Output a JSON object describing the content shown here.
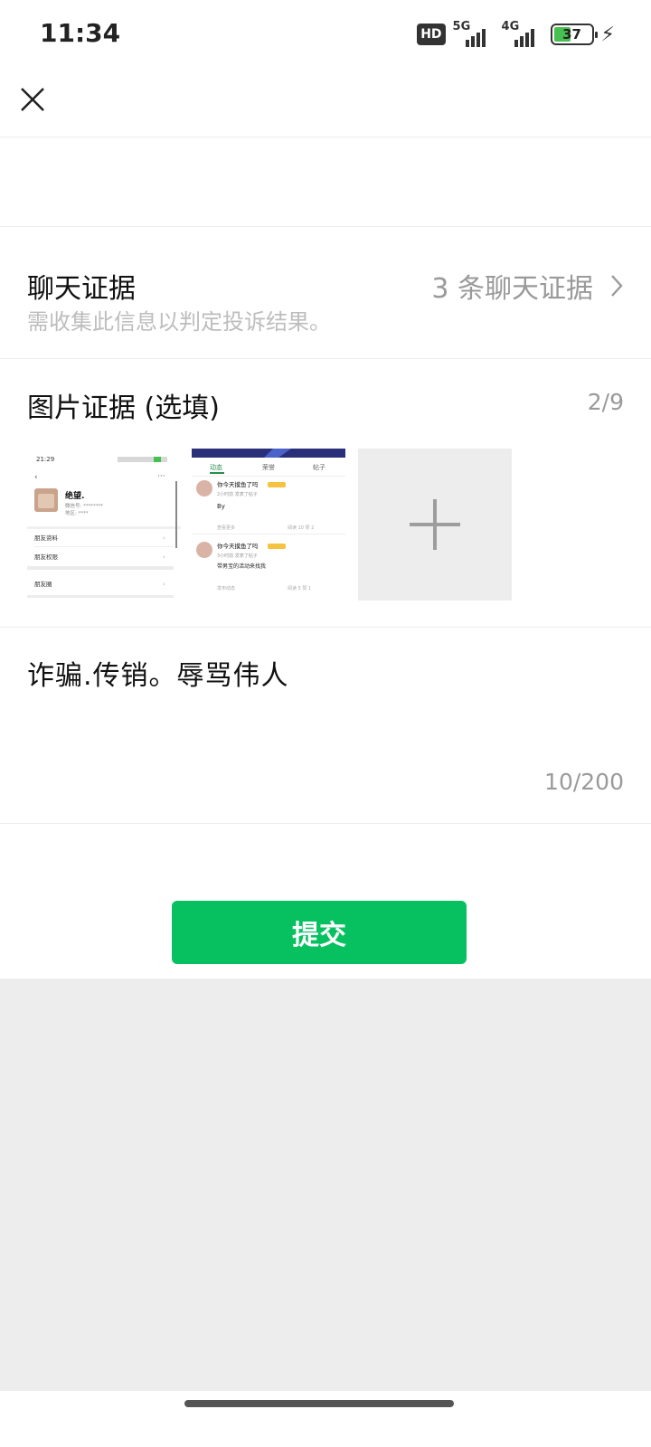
{
  "status_bar": {
    "time": "11:34",
    "hd_label": "HD",
    "network1": "5G",
    "network2": "4G",
    "battery": "37"
  },
  "form": {
    "chat_evidence": {
      "title": "聊天证据",
      "hint": "需收集此信息以判定投诉结果。",
      "value": "3 条聊天证据"
    },
    "image_evidence": {
      "title": "图片证据 (选填)",
      "counter": "2/9",
      "thumbnails": [
        {
          "time": "21:29",
          "profile_name": "绝望.",
          "id_line": "微信号: ********",
          "region_line": "地区: ****",
          "rows": [
            "朋友资料",
            "朋友权限",
            "朋友圈"
          ]
        },
        {
          "tabs": [
            "动态",
            "荣誉",
            "帖子"
          ],
          "posts": [
            {
              "name": "你今天摸鱼了吗",
              "sub": "2小时前 发表了帖子",
              "body": "By",
              "foot_left": "查看更多",
              "foot_right": "阅读 10  赞 2"
            },
            {
              "name": "你今天摸鱼了吗",
              "sub": "3小时前 发表了帖子",
              "body": "带男宝的活动来找我",
              "foot_left": "发布动态",
              "foot_right": "阅读 5  赞 1"
            }
          ]
        }
      ]
    },
    "description": {
      "text": "诈骗.传销。辱骂伟人",
      "counter": "10/200"
    },
    "submit_label": "提交"
  },
  "colors": {
    "accent": "#07c160",
    "gray_bg": "#ededed"
  },
  "icons": {
    "close": "close-icon",
    "chevron": "chevron-right-icon",
    "add": "plus-icon"
  }
}
